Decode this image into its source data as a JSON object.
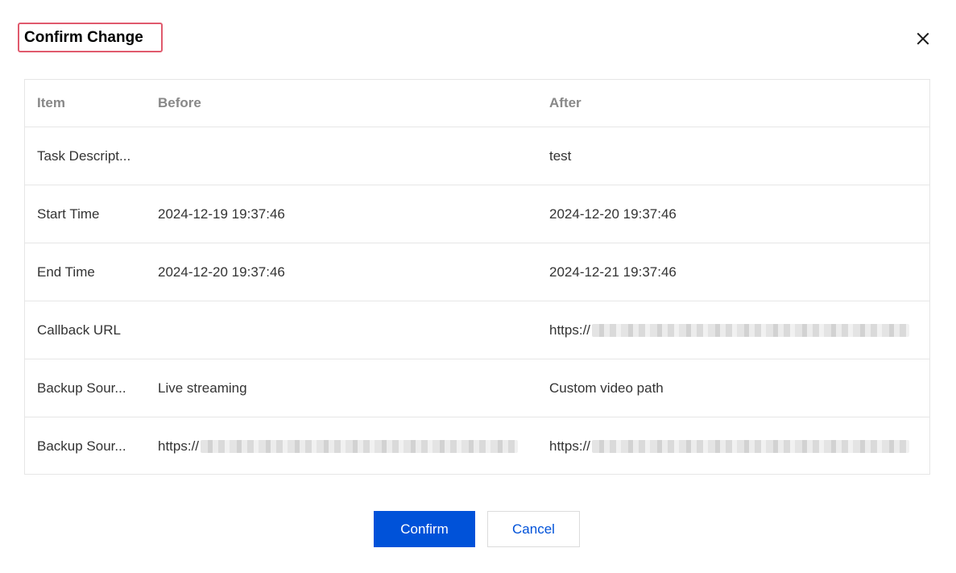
{
  "dialog": {
    "title": "Confirm Change",
    "close_icon": "close-icon"
  },
  "table": {
    "columns": [
      "Item",
      "Before",
      "After"
    ],
    "rows": [
      {
        "item": "Task Descript...",
        "before": "",
        "after": "test"
      },
      {
        "item": "Start Time",
        "before": "2024-12-19 19:37:46",
        "after": "2024-12-20 19:37:46"
      },
      {
        "item": "End Time",
        "before": "2024-12-20 19:37:46",
        "after": "2024-12-21 19:37:46"
      },
      {
        "item": "Callback URL",
        "before": "",
        "after": "https://"
      },
      {
        "item": "Backup Sour...",
        "before": "Live streaming",
        "after": "Custom video path"
      },
      {
        "item": "Backup Sour...",
        "before": "https://",
        "after": "https://"
      }
    ]
  },
  "buttons": {
    "confirm_label": "Confirm",
    "cancel_label": "Cancel"
  },
  "colors": {
    "primary": "#0052d9",
    "title_highlight_border": "#e05a6d",
    "border": "#e6e6e6",
    "header_text": "#888888"
  }
}
